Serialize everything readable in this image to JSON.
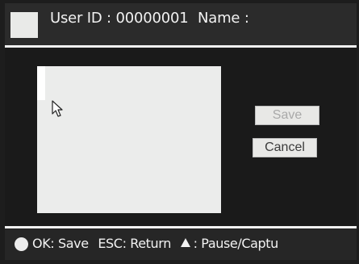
{
  "header": {
    "user_id_label": "User ID :",
    "user_id_value": "00000001",
    "name_label": "Name :",
    "name_value": ""
  },
  "dialog": {
    "save_label": "Save",
    "cancel_label": "Cancel"
  },
  "footer": {
    "ok_hint": "OK: Save",
    "esc_hint": "ESC: Return",
    "capture_hint": ": Pause/Captu"
  },
  "icons": {
    "title_icon": "square-icon",
    "cursor": "mouse-pointer-icon",
    "ok_key": "circle-icon",
    "capture_key": "triangle-up-icon"
  },
  "colors": {
    "screen_bg": "#1a1a1a",
    "text": "#f2f2f2",
    "panel": "#ebeceb",
    "button_bg": "#e8e8e6",
    "save_disabled_text": "#a9a9a9",
    "cancel_text": "#3b3b3b"
  }
}
